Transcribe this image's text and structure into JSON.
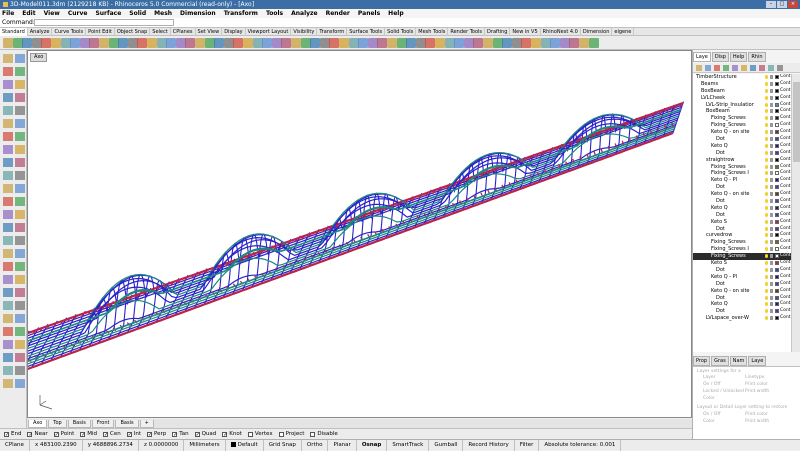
{
  "window": {
    "title": "3D-Model011.3dm (2129218 KB) - Rhinoceros 5.0 Commercial (read-only) - [Axo]"
  },
  "menu": [
    "File",
    "Edit",
    "View",
    "Curve",
    "Surface",
    "Solid",
    "Mesh",
    "Dimension",
    "Transform",
    "Tools",
    "Analyze",
    "Render",
    "Panels",
    "Help"
  ],
  "command": {
    "label": "Command:"
  },
  "toolbar_tabs": [
    "Standard",
    "Analyze",
    "Curve Tools",
    "Point Edit",
    "Object Snap",
    "Select",
    "CPlanes",
    "Set View",
    "Display",
    "Viewport Layout",
    "Visibility",
    "Transform",
    "Surface Tools",
    "Solid Tools",
    "Mesh Tools",
    "Render Tools",
    "Drafting",
    "New in V5",
    "RhinoNest 4.0",
    "Dimension",
    "eigene"
  ],
  "viewport": {
    "label": "Axo",
    "colors": {
      "red": "#b8234a",
      "blue": "#2a22c8",
      "teal": "#1c8a80"
    }
  },
  "view_tabs": [
    "Axo",
    "Top",
    "Basis",
    "Front",
    "Basis"
  ],
  "osnap": [
    {
      "label": "End",
      "checked": true
    },
    {
      "label": "Near",
      "checked": true
    },
    {
      "label": "Point",
      "checked": true
    },
    {
      "label": "Mid",
      "checked": true
    },
    {
      "label": "Cen",
      "checked": true
    },
    {
      "label": "Int",
      "checked": true
    },
    {
      "label": "Perp",
      "checked": true
    },
    {
      "label": "Tan",
      "checked": true
    },
    {
      "label": "Quad",
      "checked": true
    },
    {
      "label": "Knot",
      "checked": true
    },
    {
      "label": "Vertex",
      "checked": false
    },
    {
      "label": "Project",
      "checked": false
    },
    {
      "label": "Disable",
      "checked": false
    }
  ],
  "status": {
    "cplane": "CPlane",
    "x": "x 483100.2390",
    "y": "y 4688896.2734",
    "z": "z 0.0000000",
    "units": "Millimeters",
    "layer": "Default",
    "grid_snap": "Grid Snap",
    "ortho": "Ortho",
    "planar": "Planar",
    "osnap": "Osnap",
    "smarttrack": "SmartTrack",
    "gumball": "Gumball",
    "record_history": "Record History",
    "filter": "Filter",
    "tolerance": "Absolute tolerance: 0.001"
  },
  "panel_tabs": [
    "Laye",
    "Disp",
    "Help",
    "Rhin"
  ],
  "panel_tabs2": [
    "Prop",
    "Gras",
    "Nam",
    "Laye"
  ],
  "layers": [
    {
      "name": "TimberStructure",
      "indent": 0,
      "color": "#000000",
      "mat": "Cont"
    },
    {
      "name": "Beams",
      "indent": 1,
      "color": "#000000",
      "mat": "Cont"
    },
    {
      "name": "BoxBeam",
      "indent": 1,
      "color": "#000000",
      "mat": "Cont"
    },
    {
      "name": "LVLCheek",
      "indent": 1,
      "color": "#000000",
      "mat": "Cont"
    },
    {
      "name": "LVL-Strip_Insulation",
      "indent": 2,
      "color": "#4a8cd8",
      "mat": "Cont"
    },
    {
      "name": "BoxBeam",
      "indent": 2,
      "color": "#000000",
      "mat": "Cont"
    },
    {
      "name": "Fixing_Screws",
      "indent": 3,
      "color": "#1a1a1a",
      "mat": "Cont"
    },
    {
      "name": "Fixing_Screws",
      "indent": 3,
      "color": "#ffffff",
      "mat": "Cont"
    },
    {
      "name": "Keto Q - on site",
      "indent": 3,
      "color": "#6a3c1a",
      "mat": "Cont"
    },
    {
      "name": "Dot",
      "indent": 4,
      "color": "#4040c8",
      "mat": "Cont"
    },
    {
      "name": "Keto Q",
      "indent": 3,
      "color": "#1a1a8a",
      "mat": "Cont"
    },
    {
      "name": "Dot",
      "indent": 4,
      "color": "#3a3ad0",
      "mat": "Cont"
    },
    {
      "name": "straightrow",
      "indent": 2,
      "color": "#000000",
      "mat": "Cont"
    },
    {
      "name": "Fixing_Screws",
      "indent": 3,
      "color": "#8a5c2a",
      "mat": "Cont"
    },
    {
      "name": "Fixing_Screws I",
      "indent": 3,
      "color": "#ffffff",
      "mat": "Cont"
    },
    {
      "name": "Keto Q - Pl",
      "indent": 3,
      "color": "#1a1a8a",
      "mat": "Cont"
    },
    {
      "name": "Dot",
      "indent": 4,
      "color": "#3a3ad0",
      "mat": "Cont"
    },
    {
      "name": "Keto Q - on site",
      "indent": 3,
      "color": "#6a3c1a",
      "mat": "Cont"
    },
    {
      "name": "Dot",
      "indent": 4,
      "color": "#4040c8",
      "mat": "Cont"
    },
    {
      "name": "Keto Q",
      "indent": 3,
      "color": "#1a1a8a",
      "mat": "Cont"
    },
    {
      "name": "Dot",
      "indent": 4,
      "color": "#3a3ad0",
      "mat": "Cont"
    },
    {
      "name": "Keto S",
      "indent": 3,
      "color": "#b8234a",
      "mat": "Cont"
    },
    {
      "name": "Dot",
      "indent": 4,
      "color": "#3a3ad0",
      "mat": "Cont"
    },
    {
      "name": "curvedrow",
      "indent": 2,
      "color": "#000000",
      "mat": "Cont"
    },
    {
      "name": "Fixing_Screws",
      "indent": 3,
      "color": "#8a5c2a",
      "mat": "Cont"
    },
    {
      "name": "Fixing_Screws I",
      "indent": 3,
      "color": "#ffffff",
      "mat": "Cont"
    },
    {
      "name": "Fixing_Screws",
      "indent": 3,
      "color": "#ffffff",
      "mat": "Cont",
      "selected": true
    },
    {
      "name": "Keto S",
      "indent": 3,
      "color": "#b8234a",
      "mat": "Cont"
    },
    {
      "name": "Dot",
      "indent": 4,
      "color": "#3a3ad0",
      "mat": "Cont"
    },
    {
      "name": "Keto Q - Pl",
      "indent": 3,
      "color": "#1a1a8a",
      "mat": "Cont"
    },
    {
      "name": "Dot",
      "indent": 4,
      "color": "#3a3ad0",
      "mat": "Cont"
    },
    {
      "name": "Keto Q - on site",
      "indent": 3,
      "color": "#6a3c1a",
      "mat": "Cont"
    },
    {
      "name": "Dot",
      "indent": 4,
      "color": "#4040c8",
      "mat": "Cont"
    },
    {
      "name": "Keto Q",
      "indent": 3,
      "color": "#1a1a8a",
      "mat": "Cont"
    },
    {
      "name": "Dot",
      "indent": 4,
      "color": "#3a3ad0",
      "mat": "Cont"
    },
    {
      "name": "LVLspace_over-W",
      "indent": 2,
      "color": "#000000",
      "mat": "Cont"
    }
  ],
  "props": [
    "Layer settings for a",
    "Layer",
    "Linetype",
    "On / Off",
    "Print color",
    "Locked / Unlocked",
    "Print width",
    "Color",
    "Layout or Detail Layer setting to restore",
    "On / Off",
    "Print color",
    "Color",
    "Print width"
  ]
}
